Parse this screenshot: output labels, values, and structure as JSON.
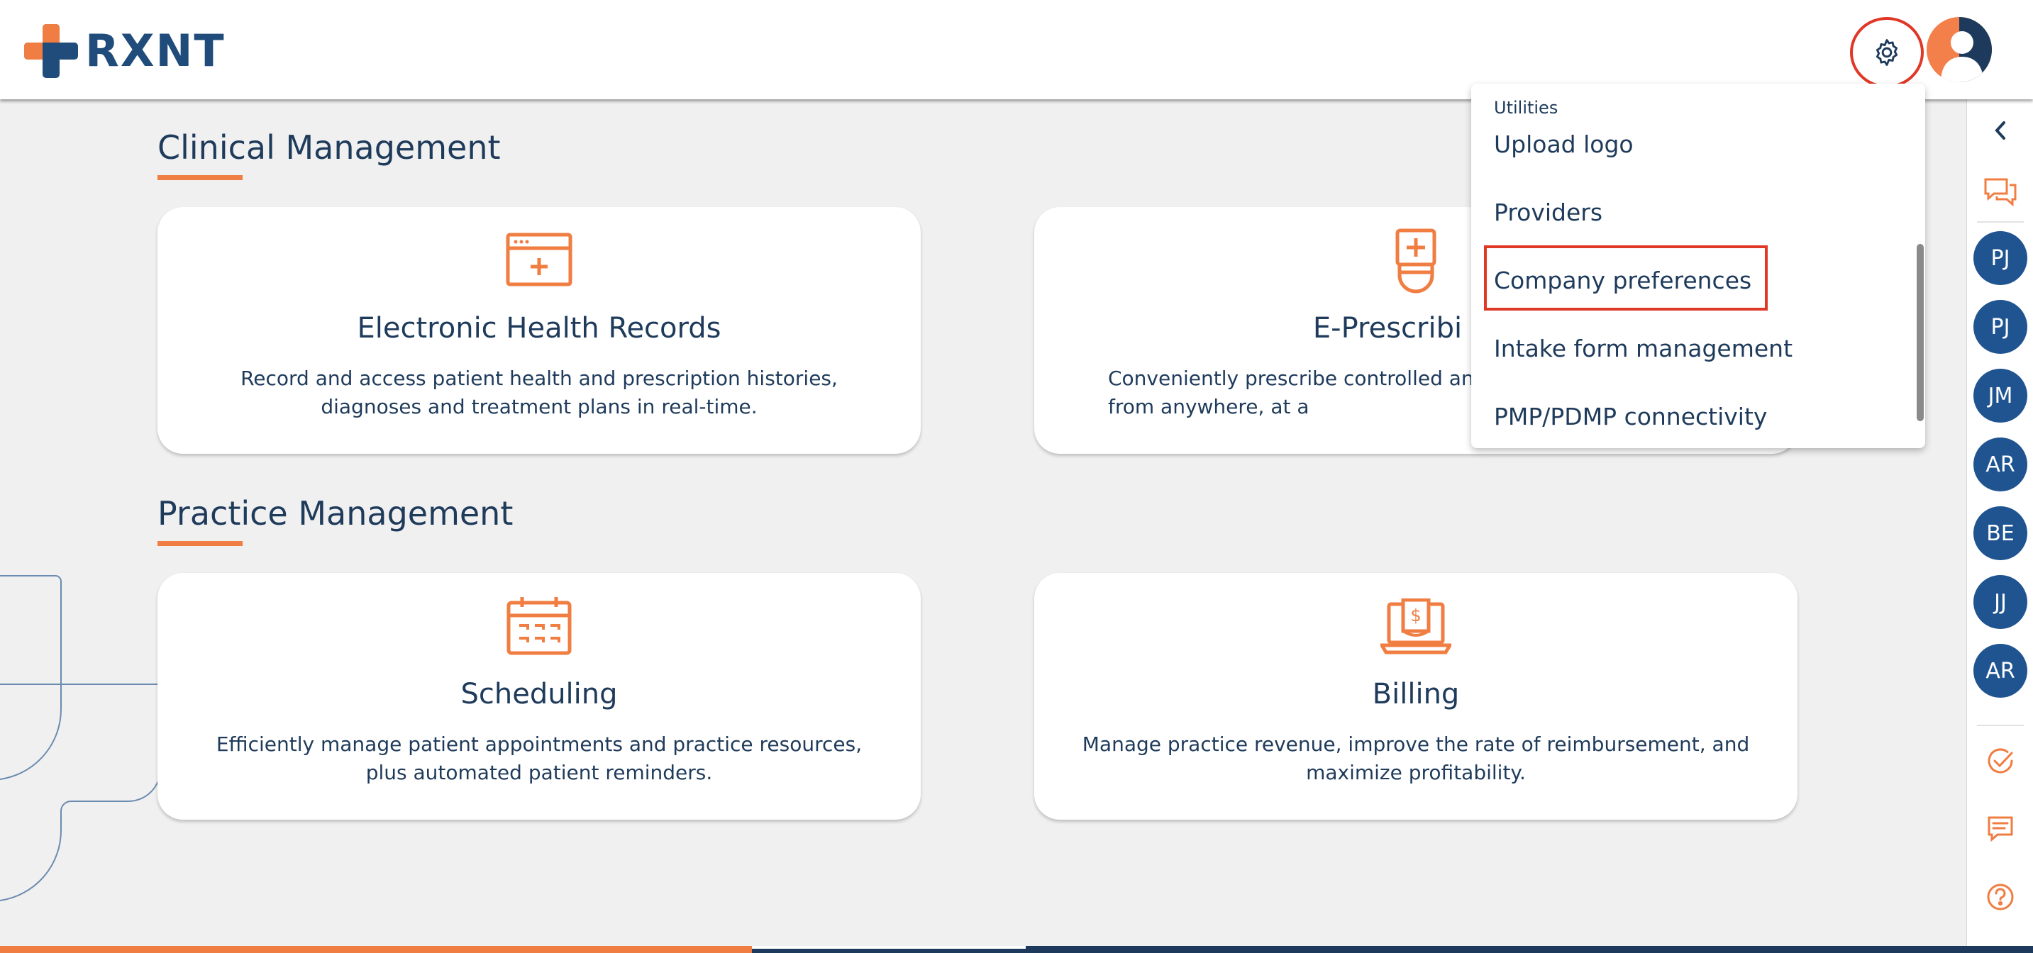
{
  "brand": {
    "name": "RXNT",
    "accent": "#f07d42",
    "navy": "#1f4c7a"
  },
  "header": {
    "settings_icon": "gear-icon",
    "avatar_icon": "user-avatar-icon"
  },
  "sections": {
    "clinical": {
      "title": "Clinical Management",
      "cards": [
        {
          "title": "Electronic Health Records",
          "desc": "Record and access patient health and prescription histories, diagnoses and treatment plans in real-time.",
          "icon": "ehr-window-icon"
        },
        {
          "title": "E-Prescribi",
          "desc": "Conveniently prescribe controlled and from anywhere, at a",
          "icon": "prescription-bottle-icon"
        }
      ]
    },
    "practice": {
      "title": "Practice Management",
      "cards": [
        {
          "title": "Scheduling",
          "desc": "Efficiently manage patient appointments and practice resources, plus automated patient reminders.",
          "icon": "calendar-icon"
        },
        {
          "title": "Billing",
          "desc": "Manage practice revenue, improve the rate of reimbursement, and maximize profitability.",
          "icon": "billing-laptop-icon"
        }
      ]
    }
  },
  "dropdown": {
    "category": "Utilities",
    "items": [
      "Upload logo",
      "Providers",
      "Company preferences",
      "Intake form management",
      "PMP/PDMP connectivity"
    ],
    "highlighted": "Company preferences"
  },
  "rail": {
    "collapse_icon": "chevron-left-icon",
    "chat_icon": "chat-bubbles-icon",
    "users": [
      "PJ",
      "PJ",
      "JM",
      "AR",
      "BE",
      "JJ",
      "AR"
    ],
    "bottom_icons": [
      "check-circle-icon",
      "message-icon",
      "help-icon"
    ]
  }
}
